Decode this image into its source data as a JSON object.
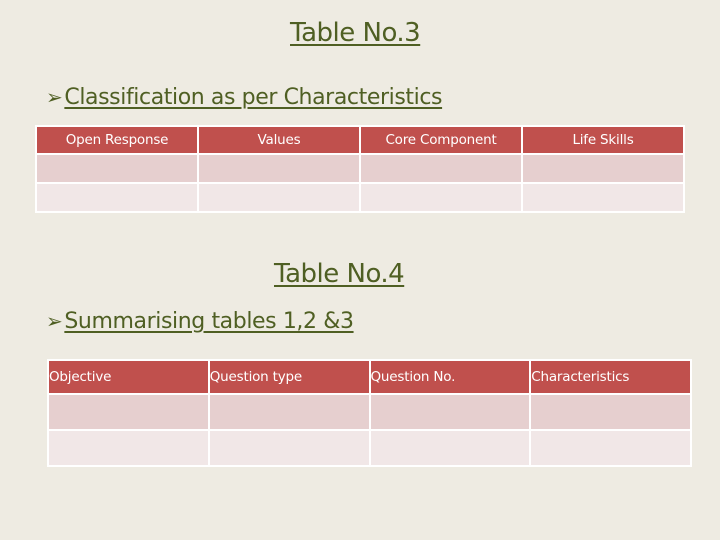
{
  "slide": {
    "table3_title": "Table No.3",
    "bullet1": {
      "icon": "arrow-bullet-icon",
      "glyph": "➢",
      "text": "Classification as per Characteristics"
    },
    "table3": {
      "headers": [
        "Open Response",
        "Values",
        "Core Component",
        "Life Skills"
      ],
      "rows": [
        [
          "",
          "",
          "",
          ""
        ],
        [
          "",
          "",
          "",
          ""
        ]
      ]
    },
    "table4_title": "Table No.4",
    "bullet2": {
      "icon": "arrow-bullet-icon",
      "glyph": "➢",
      "text": "Summarising tables 1,2 &3"
    },
    "table4": {
      "headers": [
        "Objective",
        "Question type",
        "Question No.",
        "Characteristics"
      ],
      "rows": [
        [
          "",
          "",
          "",
          ""
        ],
        [
          "",
          "",
          "",
          ""
        ]
      ]
    },
    "colors": {
      "background": "#eeebe2",
      "title_text": "#4f5f23",
      "header_fill": "#c0504d",
      "row_odd": "#e6cfcf",
      "row_even": "#f1e7e7"
    }
  }
}
